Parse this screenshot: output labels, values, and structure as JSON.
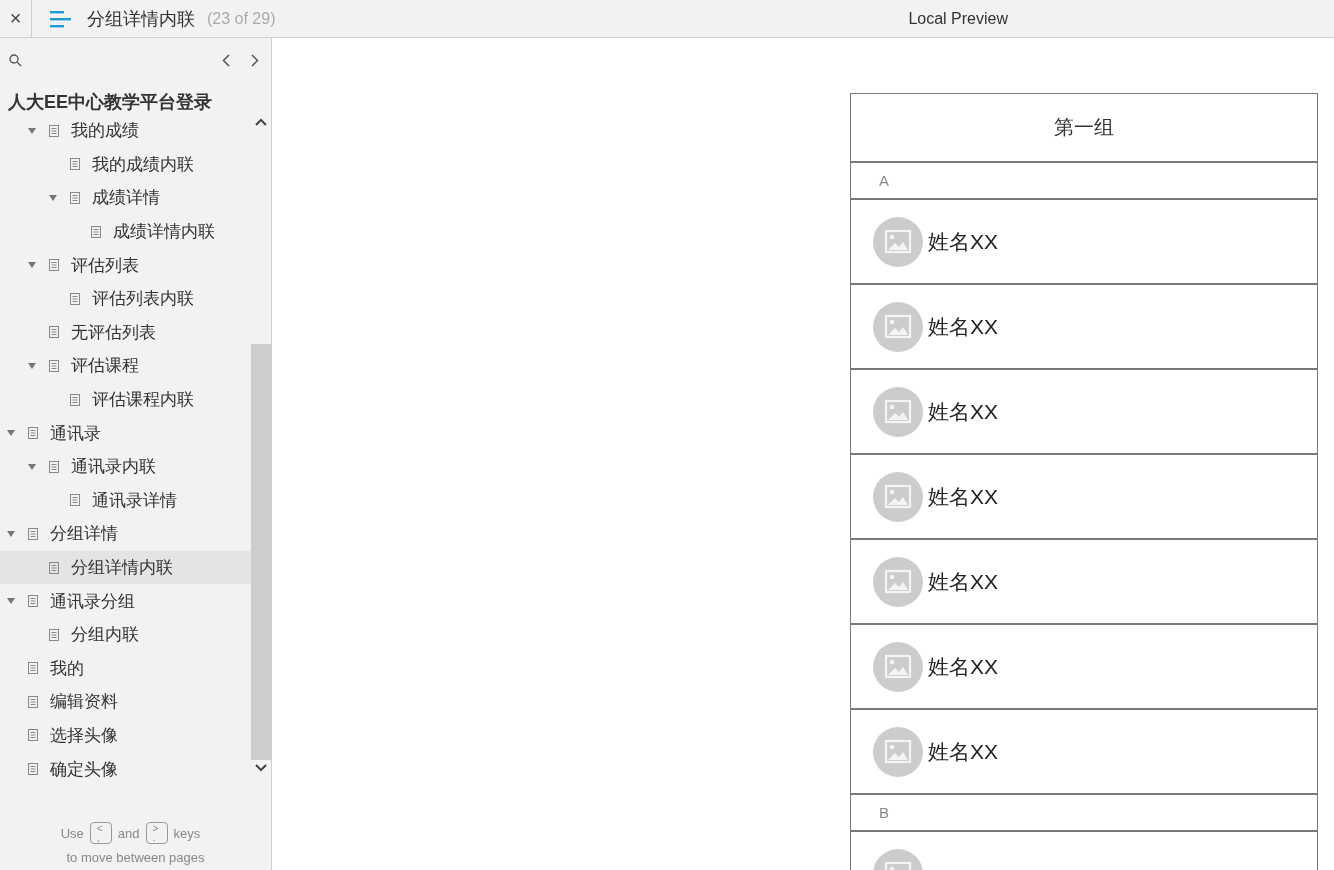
{
  "header": {
    "close": "×",
    "page_title": "分组详情内联",
    "page_count": "(23 of 29)",
    "preview_label": "Local Preview"
  },
  "sidebar": {
    "project_title": "人大EE中心教学平台登录",
    "tree": [
      {
        "children": [
          {
            "label": "我的成绩",
            "expanded": true,
            "selected": false,
            "children": [
              {
                "label": "我的成绩内联",
                "selected": false
              },
              {
                "label": "成绩详情",
                "expanded": true,
                "selected": false,
                "children": [
                  {
                    "label": "成绩详情内联",
                    "selected": false
                  }
                ]
              }
            ]
          },
          {
            "label": "评估列表",
            "expanded": true,
            "selected": false,
            "children": [
              {
                "label": "评估列表内联",
                "selected": false
              }
            ]
          },
          {
            "label": "无评估列表",
            "selected": false
          },
          {
            "label": "评估课程",
            "expanded": true,
            "selected": false,
            "children": [
              {
                "label": "评估课程内联",
                "selected": false
              }
            ]
          }
        ]
      },
      {
        "label": "通讯录",
        "expanded": true,
        "selected": false,
        "children": [
          {
            "label": "通讯录内联",
            "expanded": true,
            "selected": false,
            "children": [
              {
                "label": "通讯录详情",
                "selected": false
              }
            ]
          }
        ]
      },
      {
        "label": "分组详情",
        "expanded": true,
        "selected": false,
        "children": [
          {
            "label": "分组详情内联",
            "selected": true
          }
        ]
      },
      {
        "label": "通讯录分组",
        "expanded": true,
        "selected": false,
        "children": [
          {
            "label": "分组内联",
            "selected": false
          }
        ]
      },
      {
        "label": "我的",
        "selected": false
      },
      {
        "label": "编辑资料",
        "selected": false
      },
      {
        "label": "选择头像",
        "selected": false
      },
      {
        "label": "确定头像",
        "selected": false
      }
    ],
    "hint": {
      "use": "Use",
      "prev_key": {
        "upper": "<",
        "lower": ","
      },
      "and": "and",
      "next_key": {
        "upper": ">",
        "lower": "."
      },
      "keys": "keys",
      "line2": "to move between pages"
    }
  },
  "contact_list": {
    "title": "第一组",
    "sections": [
      {
        "letter": "A",
        "contacts": [
          {
            "avatar": true,
            "name": "姓名XX"
          },
          {
            "avatar": true,
            "name": "姓名XX"
          },
          {
            "avatar": true,
            "name": "姓名XX"
          },
          {
            "avatar": true,
            "name": "姓名XX"
          },
          {
            "avatar": true,
            "name": "姓名XX"
          },
          {
            "avatar": true,
            "name": "姓名XX"
          },
          {
            "avatar": true,
            "name": "姓名XX"
          }
        ]
      },
      {
        "letter": "B",
        "contacts": [
          {
            "avatar": true
          }
        ]
      }
    ]
  }
}
